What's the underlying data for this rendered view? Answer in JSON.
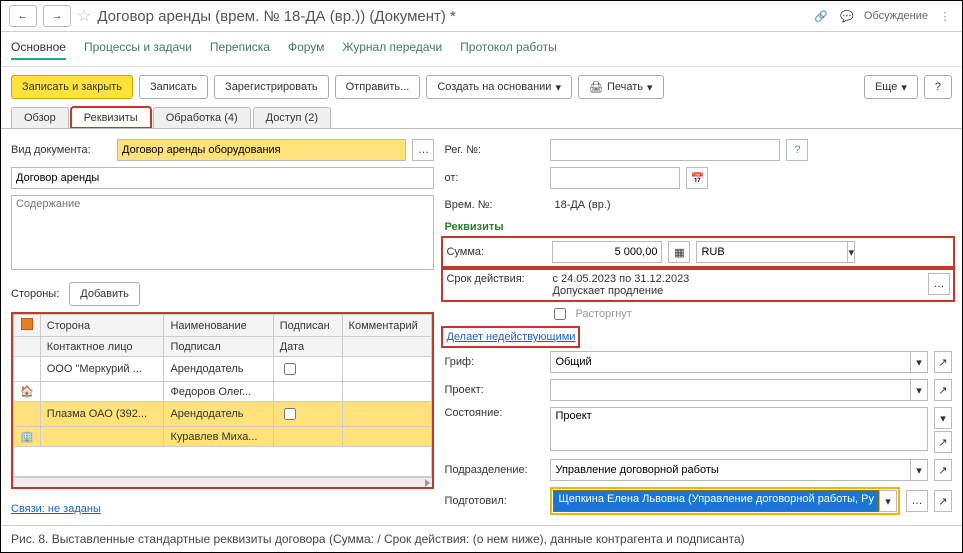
{
  "title": "Договор аренды (врем. № 18-ДА (вр.)) (Документ) *",
  "discussion": "Обсуждение",
  "links": {
    "main": "Основное",
    "proc": "Процессы и задачи",
    "corr": "Переписка",
    "forum": "Форум",
    "journal": "Журнал передачи",
    "proto": "Протокол работы"
  },
  "toolbar": {
    "save_close": "Записать и закрыть",
    "save": "Записать",
    "register": "Зарегистрировать",
    "send": "Отправить...",
    "create_base": "Создать на основании",
    "print": "Печать",
    "more": "Еще"
  },
  "tabs": {
    "overview": "Обзор",
    "req": "Реквизиты",
    "proc": "Обработка (4)",
    "access": "Доступ (2)"
  },
  "left": {
    "kind_label": "Вид документа:",
    "kind_value": "Договор аренды оборудования",
    "subject": "Договор аренды",
    "content_ph": "Содержание",
    "parties_label": "Стороны:",
    "add_btn": "Добавить",
    "cols": {
      "side": "Сторона",
      "name": "Наименование",
      "signed": "Подписан",
      "comment": "Комментарий",
      "contact": "Контактное лицо",
      "signed2": "Подписал",
      "date": "Дата"
    },
    "r1_side": "ООО \"Меркурий ...",
    "r1_name": "Арендодатель",
    "r2_name": "Федоров Олег...",
    "r3_side": "Плазма ОАО (392...",
    "r3_name": "Арендодатель",
    "r4_name": "Куравлев Миха...",
    "links_label": "Связи: не заданы"
  },
  "right": {
    "reg_label": "Рег. №:",
    "from_label": "от:",
    "temp_label": "Врем. №:",
    "temp_val": "18-ДА (вр.)",
    "req_head": "Реквизиты",
    "sum_label": "Сумма:",
    "sum_val": "5 000,00",
    "cur": "RUB",
    "period_label": "Срок действия:",
    "period_text": "с 24.05.2023 по 31.12.2023\nДопускает продление",
    "terminated": "Расторгнут",
    "invalidates": "Делает недействующими",
    "grif_label": "Гриф:",
    "grif_val": "Общий",
    "project_label": "Проект:",
    "state_label": "Состояние:",
    "state_val": "Проект",
    "dept_label": "Подразделение:",
    "dept_val": "Управление договорной работы",
    "prep_label": "Подготовил:",
    "prep_val": "Щепкина Елена Львовна (Управление договорной работы, Ру"
  },
  "caption": "Рис. 8. Выставленные стандартные реквизиты договора (Сумма: / Срок действия: (о нем ниже), данные контрагента и подписанта)"
}
